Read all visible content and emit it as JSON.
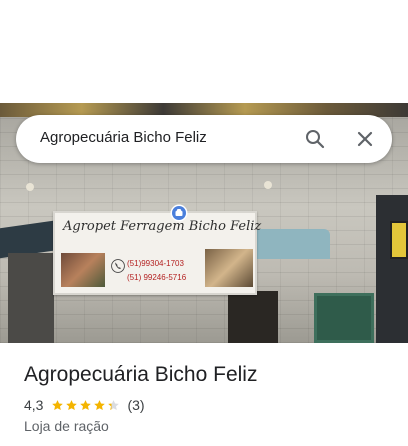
{
  "search": {
    "query": "Agropecuária Bicho Feliz"
  },
  "photo": {
    "banner_title": "Agropet Ferragem Bicho Feliz",
    "phones": [
      "(51)99304-1703",
      "(51) 99246-5716"
    ]
  },
  "place": {
    "name": "Agropecuária Bicho Feliz",
    "rating": "4,3",
    "rating_value": 4.3,
    "stars_max": 5,
    "reviews": "(3)",
    "category": "Loja de ração"
  },
  "colors": {
    "star": "#f4b400",
    "star_empty": "#dadce0",
    "text_primary": "#202124",
    "text_secondary": "#5f6368",
    "phone_text": "#b42222"
  },
  "icons": {
    "search": "search-icon",
    "close": "close-icon",
    "pin": "location-pin-icon",
    "phone": "phone-icon",
    "star": "star-icon"
  }
}
